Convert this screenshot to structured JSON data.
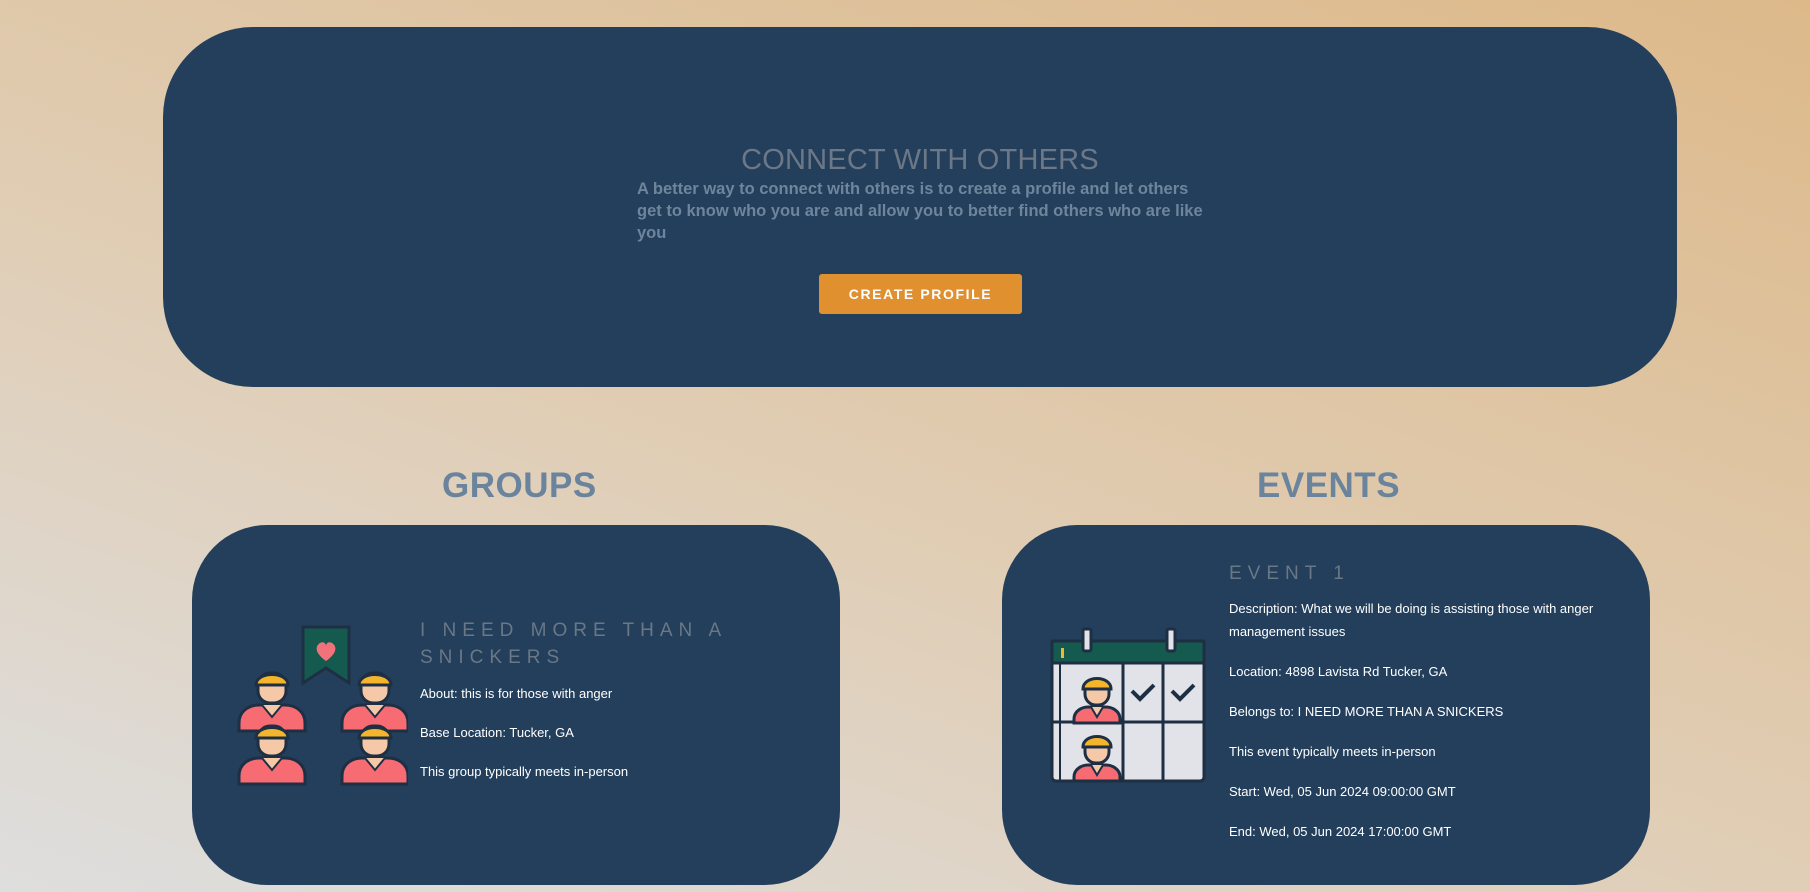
{
  "hero": {
    "title": "CONNECT WITH OTHERS",
    "text": "A better way to connect with others is to create a profile and let others get to know who you are and allow you to better find others who are like you",
    "button_label": "CREATE PROFILE"
  },
  "groups": {
    "title": "GROUPS",
    "card": {
      "icon": "group-people-icon",
      "name": "I NEED MORE THAN A SNICKERS",
      "about": "About: this is for those with anger",
      "location": "Base Location: Tucker, GA",
      "meeting": "This group typically meets in-person"
    }
  },
  "events": {
    "title": "EVENTS",
    "card": {
      "icon": "event-calendar-icon",
      "name": "EVENT 1",
      "description": "Description: What we will be doing is assisting those with anger management issues",
      "location": "Location: 4898 Lavista Rd Tucker, GA",
      "belongs_to": "Belongs to: I NEED MORE THAN A SNICKERS",
      "meeting": "This event typically meets in-person",
      "start": "Start: Wed, 05 Jun 2024 09:00:00 GMT",
      "end": "End: Wed, 05 Jun 2024 17:00:00 GMT"
    }
  },
  "colors": {
    "panel": "#233f5c",
    "accent": "#e0902f",
    "heading": "#6a849d"
  }
}
